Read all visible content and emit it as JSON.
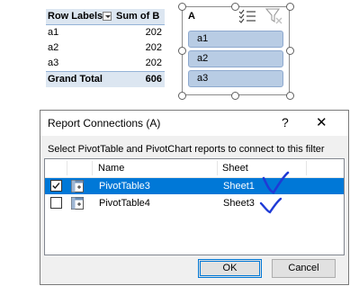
{
  "pivot": {
    "header_row_labels": "Row Labels",
    "header_sum": "Sum of B",
    "rows": [
      {
        "label": "a1",
        "value": "202"
      },
      {
        "label": "a2",
        "value": "202"
      },
      {
        "label": "a3",
        "value": "202"
      }
    ],
    "total_label": "Grand Total",
    "total_value": "606"
  },
  "slicer": {
    "title": "A",
    "items": [
      "a1",
      "a2",
      "a3"
    ],
    "multi_select_icon": "multi-select-icon",
    "clear_filter_icon": "clear-filter-icon"
  },
  "dialog": {
    "title": "Report Connections (A)",
    "help": "?",
    "close": "✕",
    "instruction": "Select PivotTable and PivotChart reports to connect to this filter",
    "columns": {
      "name": "Name",
      "sheet": "Sheet"
    },
    "rows": [
      {
        "name": "PivotTable3",
        "sheet": "Sheet1",
        "checked": true,
        "selected": true
      },
      {
        "name": "PivotTable4",
        "sheet": "Sheet3",
        "checked": false,
        "selected": false
      }
    ],
    "ok_label": "OK",
    "cancel_label": "Cancel"
  },
  "colors": {
    "selection": "#0078d7",
    "slicer_item": "#b8cce4",
    "pivot_header": "#dce6f1",
    "annotation_ink": "#1f3bd6"
  }
}
